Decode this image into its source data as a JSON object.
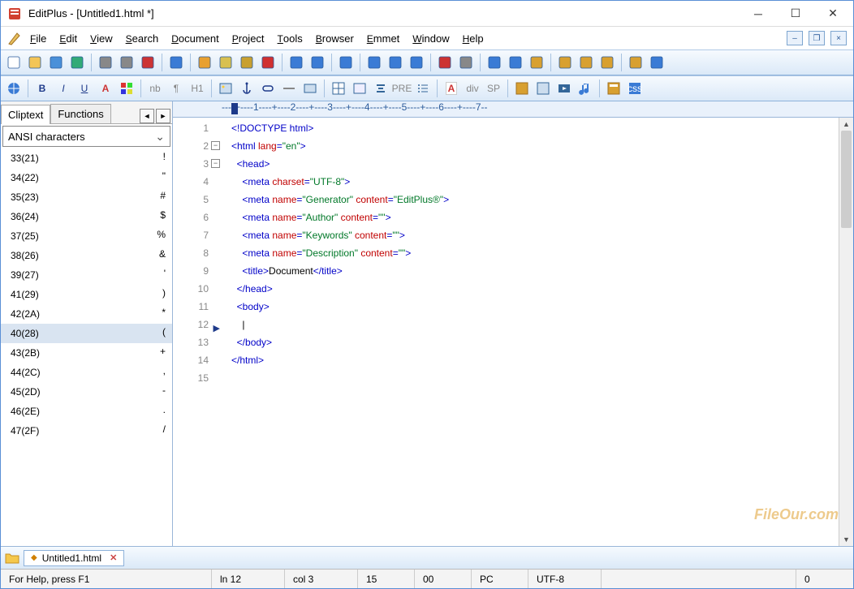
{
  "title": "EditPlus - [Untitled1.html *]",
  "menu": [
    "File",
    "Edit",
    "View",
    "Search",
    "Document",
    "Project",
    "Tools",
    "Browser",
    "Emmet",
    "Window",
    "Help"
  ],
  "sidebar": {
    "tabs": [
      "Cliptext",
      "Functions"
    ],
    "combo": "ANSI characters",
    "items": [
      {
        "code": "33(21)",
        "ch": "!"
      },
      {
        "code": "34(22)",
        "ch": "\""
      },
      {
        "code": "35(23)",
        "ch": "#"
      },
      {
        "code": "36(24)",
        "ch": "$"
      },
      {
        "code": "37(25)",
        "ch": "%"
      },
      {
        "code": "38(26)",
        "ch": "&"
      },
      {
        "code": "39(27)",
        "ch": "'"
      },
      {
        "code": "41(29)",
        "ch": ")"
      },
      {
        "code": "42(2A)",
        "ch": "*"
      },
      {
        "code": "40(28)",
        "ch": "("
      },
      {
        "code": "43(2B)",
        "ch": "+"
      },
      {
        "code": "44(2C)",
        "ch": ","
      },
      {
        "code": "45(2D)",
        "ch": "-"
      },
      {
        "code": "46(2E)",
        "ch": "."
      },
      {
        "code": "47(2F)",
        "ch": "/"
      }
    ],
    "selectedIndex": 9
  },
  "code": {
    "lines": [
      [
        {
          "t": "<!DOCTYPE html>",
          "c": "k-tag"
        }
      ],
      [
        {
          "t": "<html ",
          "c": "k-tag"
        },
        {
          "t": "lang",
          "c": "k-attr"
        },
        {
          "t": "=",
          "c": "k-tag"
        },
        {
          "t": "\"en\"",
          "c": "k-val"
        },
        {
          "t": ">",
          "c": "k-tag"
        }
      ],
      [
        {
          "t": "  ",
          "c": ""
        },
        {
          "t": "<head>",
          "c": "k-tag"
        }
      ],
      [
        {
          "t": "    ",
          "c": ""
        },
        {
          "t": "<meta ",
          "c": "k-tag"
        },
        {
          "t": "charset",
          "c": "k-attr"
        },
        {
          "t": "=",
          "c": "k-tag"
        },
        {
          "t": "\"UTF-8\"",
          "c": "k-val"
        },
        {
          "t": ">",
          "c": "k-tag"
        }
      ],
      [
        {
          "t": "    ",
          "c": ""
        },
        {
          "t": "<meta ",
          "c": "k-tag"
        },
        {
          "t": "name",
          "c": "k-attr"
        },
        {
          "t": "=",
          "c": "k-tag"
        },
        {
          "t": "\"Generator\"",
          "c": "k-val"
        },
        {
          "t": " ",
          "c": ""
        },
        {
          "t": "content",
          "c": "k-attr"
        },
        {
          "t": "=",
          "c": "k-tag"
        },
        {
          "t": "\"EditPlus®\"",
          "c": "k-val"
        },
        {
          "t": ">",
          "c": "k-tag"
        }
      ],
      [
        {
          "t": "    ",
          "c": ""
        },
        {
          "t": "<meta ",
          "c": "k-tag"
        },
        {
          "t": "name",
          "c": "k-attr"
        },
        {
          "t": "=",
          "c": "k-tag"
        },
        {
          "t": "\"Author\"",
          "c": "k-val"
        },
        {
          "t": " ",
          "c": ""
        },
        {
          "t": "content",
          "c": "k-attr"
        },
        {
          "t": "=",
          "c": "k-tag"
        },
        {
          "t": "\"\"",
          "c": "k-val"
        },
        {
          "t": ">",
          "c": "k-tag"
        }
      ],
      [
        {
          "t": "    ",
          "c": ""
        },
        {
          "t": "<meta ",
          "c": "k-tag"
        },
        {
          "t": "name",
          "c": "k-attr"
        },
        {
          "t": "=",
          "c": "k-tag"
        },
        {
          "t": "\"Keywords\"",
          "c": "k-val"
        },
        {
          "t": " ",
          "c": ""
        },
        {
          "t": "content",
          "c": "k-attr"
        },
        {
          "t": "=",
          "c": "k-tag"
        },
        {
          "t": "\"\"",
          "c": "k-val"
        },
        {
          "t": ">",
          "c": "k-tag"
        }
      ],
      [
        {
          "t": "    ",
          "c": ""
        },
        {
          "t": "<meta ",
          "c": "k-tag"
        },
        {
          "t": "name",
          "c": "k-attr"
        },
        {
          "t": "=",
          "c": "k-tag"
        },
        {
          "t": "\"Description\"",
          "c": "k-val"
        },
        {
          "t": " ",
          "c": ""
        },
        {
          "t": "content",
          "c": "k-attr"
        },
        {
          "t": "=",
          "c": "k-tag"
        },
        {
          "t": "\"\"",
          "c": "k-val"
        },
        {
          "t": ">",
          "c": "k-tag"
        }
      ],
      [
        {
          "t": "    ",
          "c": ""
        },
        {
          "t": "<title>",
          "c": "k-tag"
        },
        {
          "t": "Document",
          "c": "k-txt"
        },
        {
          "t": "</title>",
          "c": "k-tag"
        }
      ],
      [
        {
          "t": "  ",
          "c": ""
        },
        {
          "t": "</head>",
          "c": "k-tag"
        }
      ],
      [
        {
          "t": "  ",
          "c": ""
        },
        {
          "t": "<body>",
          "c": "k-tag"
        }
      ],
      [
        {
          "t": "    ",
          "c": ""
        }
      ],
      [
        {
          "t": "  ",
          "c": ""
        },
        {
          "t": "</body>",
          "c": "k-tag"
        }
      ],
      [
        {
          "t": "</html>",
          "c": "k-tag"
        }
      ],
      [
        {
          "t": "",
          "c": ""
        }
      ]
    ],
    "foldLines": [
      2,
      3
    ],
    "currentLine": 12
  },
  "ruler": "----+----1----+----2----+----3----+----4----+----5----+----6----+----7--",
  "fileTabs": {
    "active": "Untitled1.html"
  },
  "status": {
    "help": "For Help, press F1",
    "ln": "ln 12",
    "col": "col 3",
    "sel": "15",
    "ovr": "00",
    "mode": "PC",
    "enc": "UTF-8",
    "readonly": "0"
  },
  "toolbar2_labels": [
    "B",
    "I",
    "U",
    "A",
    "nb",
    "¶",
    "H1",
    "PRE",
    "div",
    "SP"
  ],
  "watermark": "FileOur.com"
}
